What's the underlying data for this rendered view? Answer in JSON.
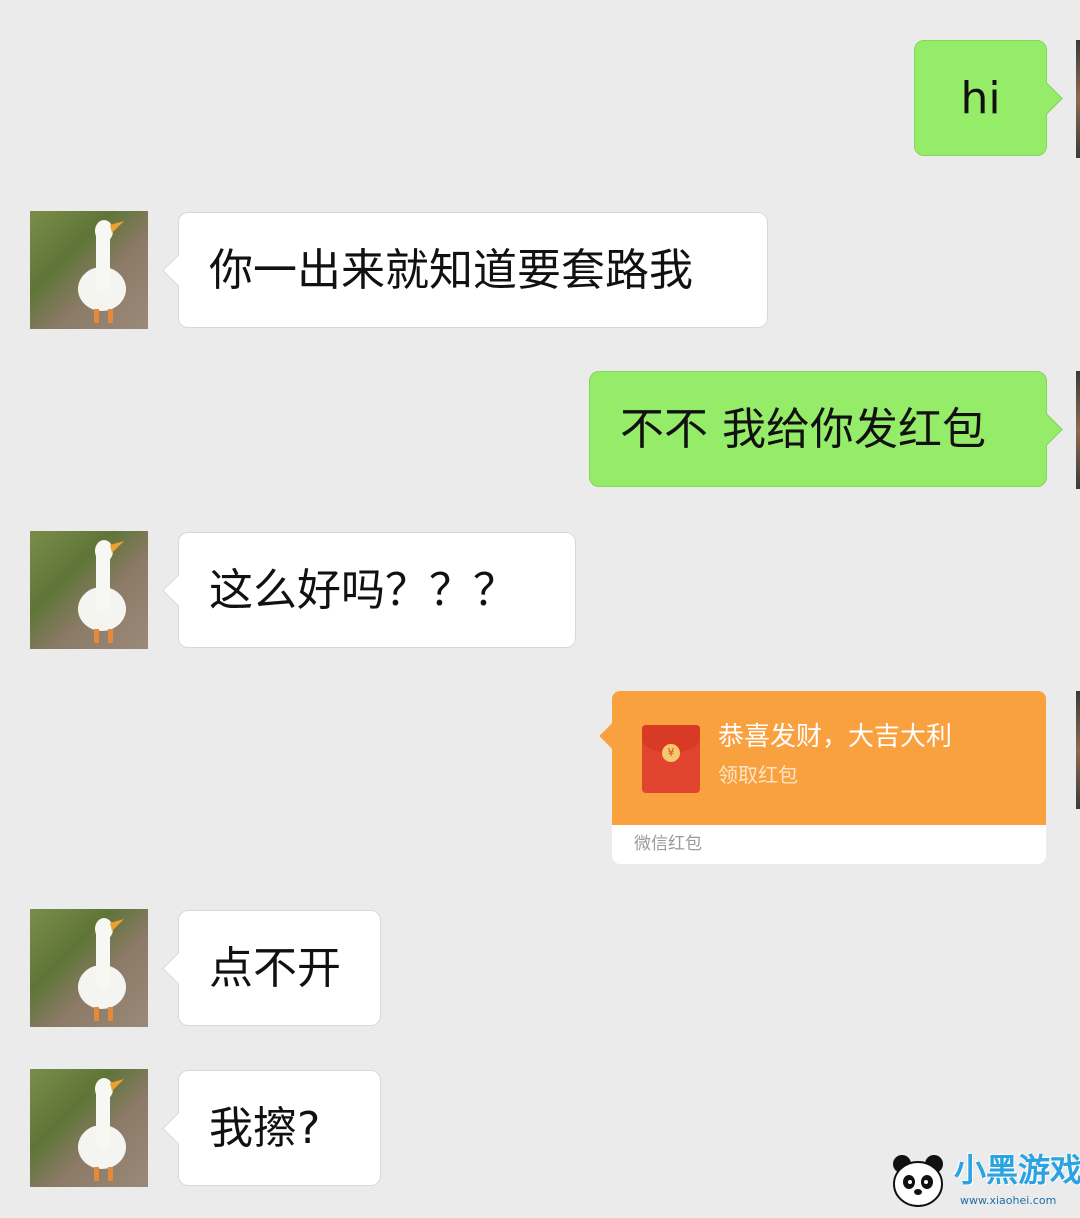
{
  "messages": [
    {
      "side": "out",
      "text": "hi"
    },
    {
      "side": "in",
      "text": "你一出来就知道要套路我"
    },
    {
      "side": "out",
      "text": "不不 我给你发红包"
    },
    {
      "side": "in",
      "text": "这么好吗？？？"
    },
    {
      "side": "out",
      "type": "red-packet",
      "title": "恭喜发财，大吉大利",
      "subtitle": "领取红包",
      "footer": "微信红包"
    },
    {
      "side": "in",
      "text": "点不开"
    },
    {
      "side": "in",
      "text": "我擦?"
    }
  ],
  "watermark": {
    "logo_text": "小黑游戏",
    "url": "www.xiaohei.com"
  },
  "colors": {
    "background": "#ebebeb",
    "incoming_bubble": "#ffffff",
    "outgoing_bubble": "#95ec69",
    "red_packet": "#f9a03f"
  }
}
